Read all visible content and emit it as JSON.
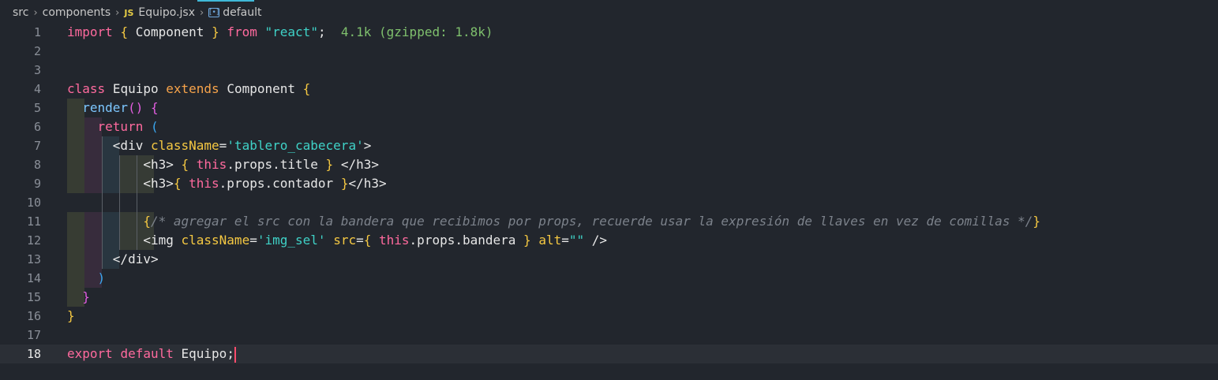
{
  "breadcrumb": {
    "folder1": "src",
    "folder2": "components",
    "file_badge": "JS",
    "file": "Equipo.jsx",
    "symbol": "default"
  },
  "lines": [
    {
      "n": "1"
    },
    {
      "n": "2"
    },
    {
      "n": "3"
    },
    {
      "n": "4"
    },
    {
      "n": "5"
    },
    {
      "n": "6"
    },
    {
      "n": "7"
    },
    {
      "n": "8"
    },
    {
      "n": "9"
    },
    {
      "n": "10"
    },
    {
      "n": "11"
    },
    {
      "n": "12"
    },
    {
      "n": "13"
    },
    {
      "n": "14"
    },
    {
      "n": "15"
    },
    {
      "n": "16"
    },
    {
      "n": "17"
    },
    {
      "n": "18"
    }
  ],
  "code": {
    "l1": {
      "import": "import",
      "ob": "{",
      "name": "Component",
      "cb": "}",
      "from": "from",
      "mod": "\"react\"",
      "semi": ";",
      "size_hint": "4.1k (gzipped: 1.8k)"
    },
    "l4": {
      "class": "class",
      "name": "Equipo",
      "extends": "extends",
      "parent": "Component",
      "ob": "{"
    },
    "l5": {
      "method": "render",
      "parens": "()",
      "ob": "{"
    },
    "l6": {
      "ret": "return",
      "op": "("
    },
    "l7": {
      "open": "<div",
      "attr": "className",
      "eq": "=",
      "val": "'tablero_cabecera'",
      "close": ">"
    },
    "l8": {
      "open": "<h3>",
      "ob": "{",
      "this": "this",
      "expr": ".props.title",
      "cb": "}",
      "close": "</h3>"
    },
    "l9": {
      "open": "<h3>",
      "ob": "{",
      "this": "this",
      "expr": ".props.contador",
      "cb": "}",
      "close": "</h3>"
    },
    "l11": {
      "ob": "{",
      "comment": "/* agregar el src con la bandera que recibimos por props, recuerde usar la expresión de llaves en vez de comillas */",
      "cb": "}"
    },
    "l12": {
      "open": "<img",
      "attr1": "className",
      "eq1": "=",
      "val1": "'img_sel'",
      "attr2": "src",
      "eq2": "=",
      "ob": "{",
      "this": "this",
      "expr": ".props.bandera",
      "cb": "}",
      "attr3": "alt",
      "eq3": "=",
      "val3": "\"\"",
      "close": "/>"
    },
    "l13": {
      "close": "</div>"
    },
    "l14": {
      "cp": ")"
    },
    "l15": {
      "cb": "}"
    },
    "l16": {
      "cb": "}"
    },
    "l18": {
      "export": "export",
      "default": "default",
      "name": "Equipo",
      "semi": ";"
    }
  },
  "colors": {
    "background": "#22262d",
    "keyword": "#f7a34a",
    "keyword_pink": "#ff6a9e",
    "string": "#3fd2c7",
    "bracket_gold": "#f5c842",
    "bracket_magenta": "#e35ee0",
    "bracket_blue": "#3aa7f0",
    "comment": "#7c828b",
    "import_cost": "#7fc06d",
    "cursor": "#ff4d6d"
  }
}
